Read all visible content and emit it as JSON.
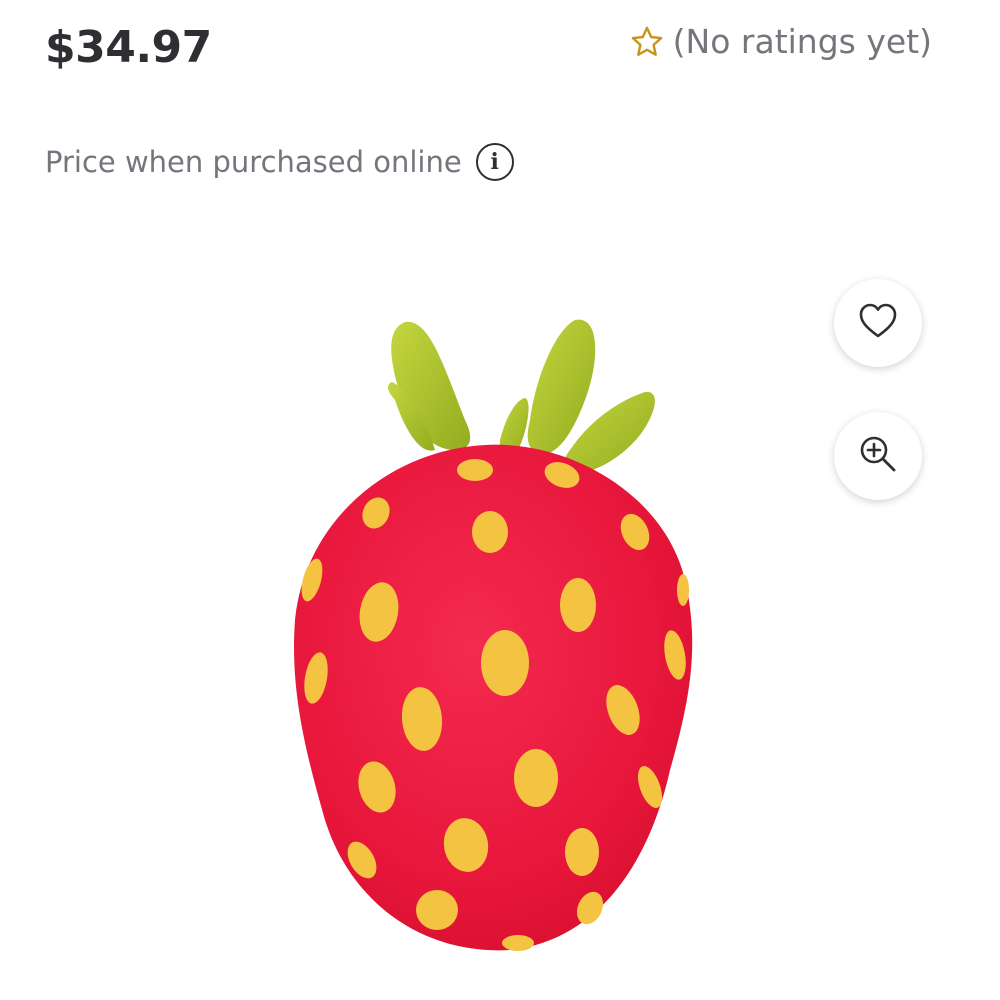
{
  "product": {
    "price": "$34.97",
    "rating_text": "(No ratings yet)",
    "price_note": "Price when purchased online",
    "info_icon_glyph": "i",
    "image_alt": "strawberry-plush-image"
  },
  "icons": {
    "rating_star": "star-outline-icon",
    "info": "info-icon",
    "favorite": "heart-outline-icon",
    "zoom": "zoom-in-icon"
  },
  "colors": {
    "price_text": "#2e2f32",
    "secondary_text": "#74767c",
    "star": "#c7941b",
    "strawberry_red": "#e8173c",
    "seed_yellow": "#f5c342",
    "leaf_green": "#a9c12b"
  }
}
